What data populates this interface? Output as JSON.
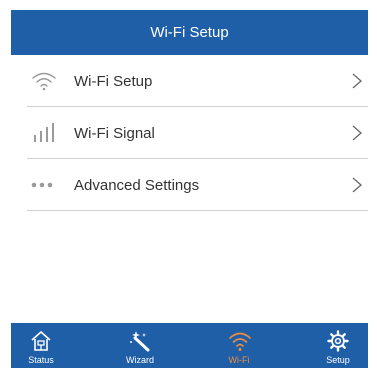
{
  "header": {
    "title": "Wi-Fi Setup"
  },
  "menu": {
    "items": [
      {
        "label": "Wi-Fi Setup",
        "icon": "wifi-icon"
      },
      {
        "label": "Wi-Fi Signal",
        "icon": "signal-bars-icon"
      },
      {
        "label": "Advanced Settings",
        "icon": "more-dots-icon"
      }
    ]
  },
  "tabbar": {
    "tabs": [
      {
        "label": "Status",
        "icon": "home-status-icon"
      },
      {
        "label": "Wizard",
        "icon": "magic-wand-icon"
      },
      {
        "label": "Wi-Fi",
        "icon": "wifi-icon",
        "active": true
      },
      {
        "label": "Setup",
        "icon": "gear-icon"
      }
    ]
  },
  "colors": {
    "primary": "#1e5fa8",
    "active_tab": "#f08c3c",
    "icon_gray": "#9a9a9a",
    "divider": "#cfcfcf"
  }
}
